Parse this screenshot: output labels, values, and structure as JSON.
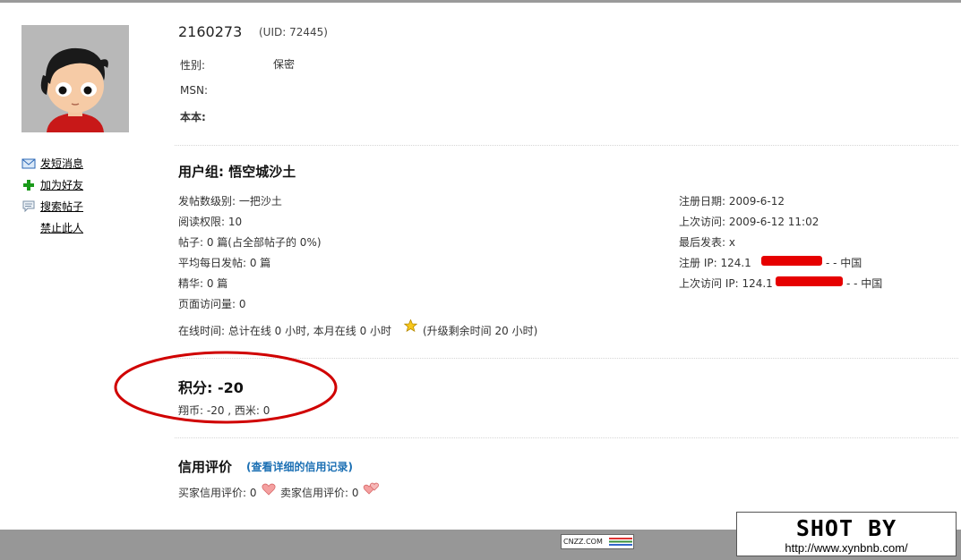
{
  "profile": {
    "username": "2160273",
    "uid": "(UID: 72445)",
    "fields": [
      {
        "label": "性别:",
        "value": "保密"
      },
      {
        "label": "MSN:",
        "value": ""
      },
      {
        "label": "本本:",
        "value": ""
      }
    ]
  },
  "actions": [
    {
      "label": "发短消息",
      "icon": "envelope-icon"
    },
    {
      "label": "加为好友",
      "icon": "plus-icon"
    },
    {
      "label": "搜索帖子",
      "icon": "speech-bubble-icon"
    },
    {
      "label": "禁止此人",
      "icon": ""
    }
  ],
  "usergroup": {
    "title": "用户组: 悟空城沙土",
    "left": [
      "发帖数级别: 一把沙土",
      "阅读权限: 10",
      "帖子: 0 篇(占全部帖子的 0%)",
      "平均每日发帖: 0 篇",
      "精华: 0 篇",
      "页面访问量: 0"
    ],
    "right": [
      "注册日期: 2009-6-12",
      "上次访问: 2009-6-12 11:02",
      "最后发表: x",
      {
        "prefix": "注册 IP: 124.1",
        "suffix": "- - 中国"
      },
      {
        "prefix": "上次访问 IP: 124.1",
        "suffix": "- - 中国"
      }
    ],
    "online_text": "在线时间: 总计在线  0 小时, 本月在线  0 小时",
    "upgrade_text": "(升级剩余时间  20 小时)",
    "star_icon": "star-icon"
  },
  "credits": {
    "title": "积分: -20",
    "detail": "翔币: -20 , 西米: 0"
  },
  "credit_rating": {
    "title": "信用评价",
    "link": "(查看详细的信用记录)",
    "buyer": "买家信用评价: 0",
    "seller": "卖家信用评价: 0"
  },
  "footer": {
    "cnzz": "CNZZ.COM",
    "shot_by": "SHOT BY",
    "shot_url": "http://www.xynbnb.com/"
  },
  "colors": {
    "annotation_circle": "#d00000",
    "redaction": "#e60000",
    "link_blue": "#1c70b4"
  }
}
